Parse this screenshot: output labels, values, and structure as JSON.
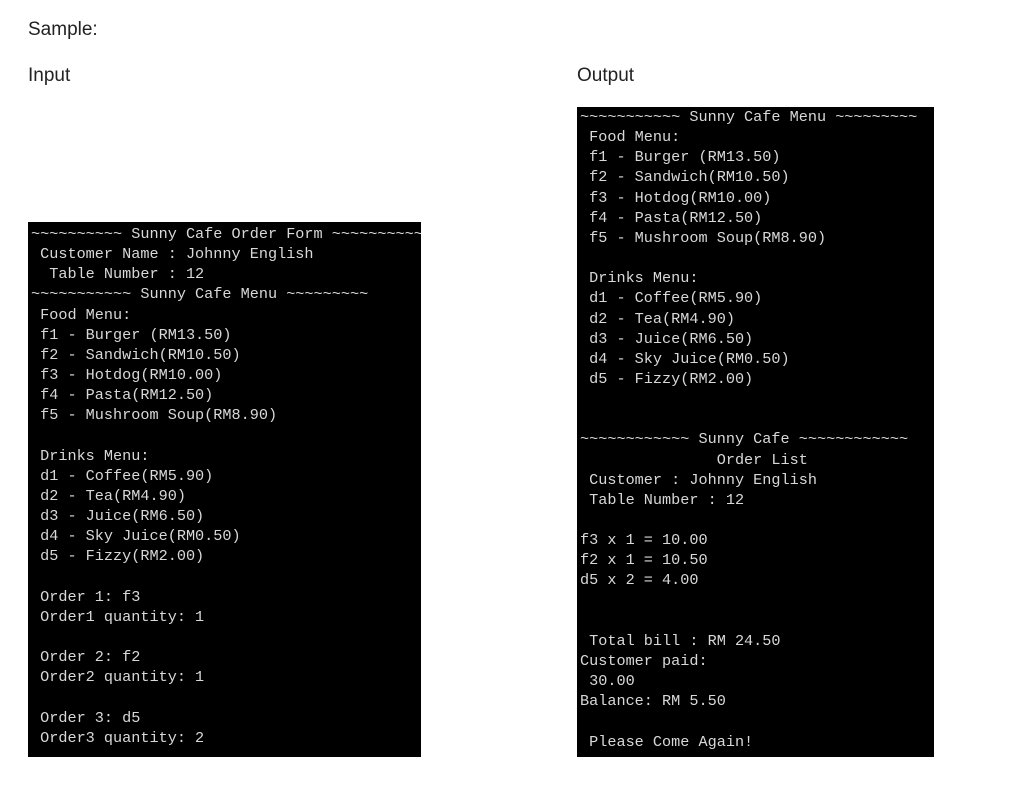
{
  "labels": {
    "sample": "Sample:",
    "input": "Input",
    "output": "Output"
  },
  "input_console": {
    "lines": [
      "~~~~~~~~~~ Sunny Cafe Order Form ~~~~~~~~~~",
      " Customer Name : Johnny English",
      "  Table Number : 12",
      "~~~~~~~~~~~ Sunny Cafe Menu ~~~~~~~~~",
      " Food Menu:",
      " f1 - Burger (RM13.50)",
      " f2 - Sandwich(RM10.50)",
      " f3 - Hotdog(RM10.00)",
      " f4 - Pasta(RM12.50)",
      " f5 - Mushroom Soup(RM8.90)",
      "",
      " Drinks Menu:",
      " d1 - Coffee(RM5.90)",
      " d2 - Tea(RM4.90)",
      " d3 - Juice(RM6.50)",
      " d4 - Sky Juice(RM0.50)",
      " d5 - Fizzy(RM2.00)",
      "",
      " Order 1: f3",
      " Order1 quantity: 1",
      "",
      " Order 2: f2",
      " Order2 quantity: 1",
      "",
      " Order 3: d5",
      " Order3 quantity: 2"
    ]
  },
  "output_console": {
    "lines": [
      "~~~~~~~~~~~ Sunny Cafe Menu ~~~~~~~~~",
      " Food Menu:",
      " f1 - Burger (RM13.50)",
      " f2 - Sandwich(RM10.50)",
      " f3 - Hotdog(RM10.00)",
      " f4 - Pasta(RM12.50)",
      " f5 - Mushroom Soup(RM8.90)",
      "",
      " Drinks Menu:",
      " d1 - Coffee(RM5.90)",
      " d2 - Tea(RM4.90)",
      " d3 - Juice(RM6.50)",
      " d4 - Sky Juice(RM0.50)",
      " d5 - Fizzy(RM2.00)",
      "",
      "",
      "~~~~~~~~~~~~ Sunny Cafe ~~~~~~~~~~~~",
      "               Order List",
      " Customer : Johnny English",
      " Table Number : 12",
      "",
      "f3 x 1 = 10.00",
      "f2 x 1 = 10.50",
      "d5 x 2 = 4.00",
      "",
      "",
      " Total bill : RM 24.50",
      "Customer paid:",
      " 30.00",
      "Balance: RM 5.50",
      "",
      " Please Come Again!"
    ]
  }
}
